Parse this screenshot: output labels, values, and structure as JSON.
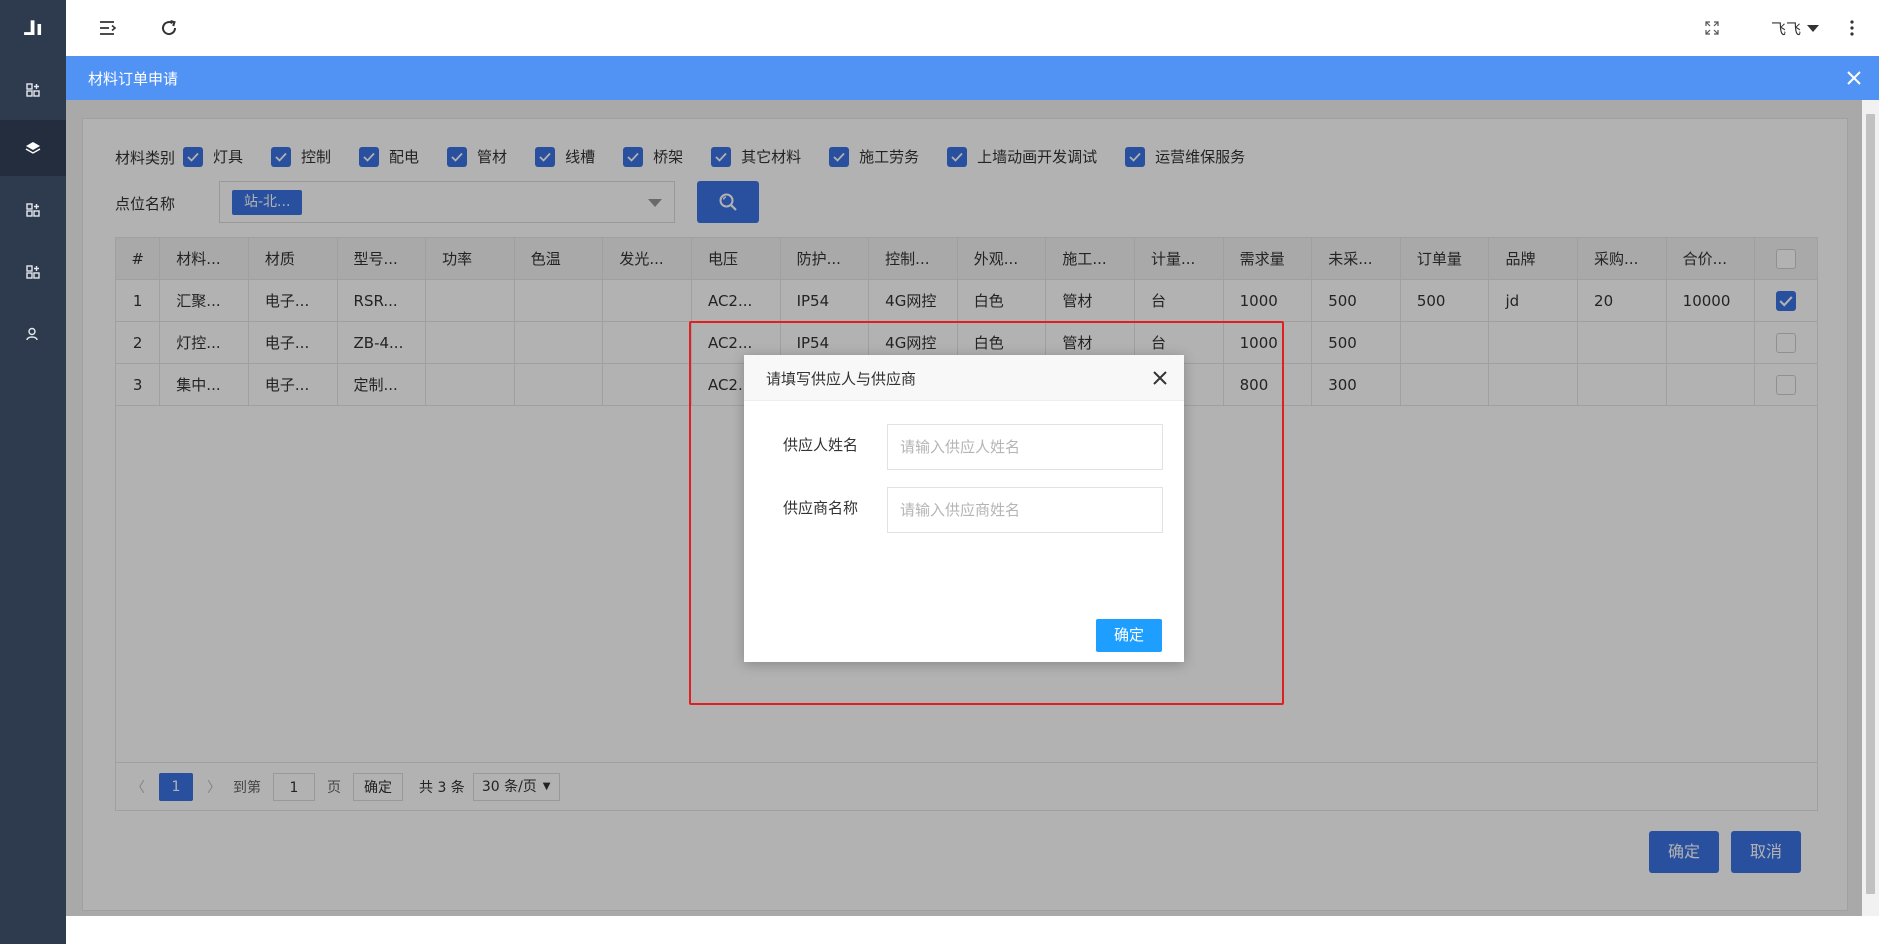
{
  "app": {
    "logo_text": "⅃ı",
    "user_name": "飞飞"
  },
  "panel": {
    "title": "材料订单申请"
  },
  "filters": {
    "category_label": "材料类别",
    "categories": [
      {
        "label": "灯具",
        "checked": true
      },
      {
        "label": "控制",
        "checked": true
      },
      {
        "label": "配电",
        "checked": true
      },
      {
        "label": "管材",
        "checked": true
      },
      {
        "label": "线槽",
        "checked": true
      },
      {
        "label": "桥架",
        "checked": true
      },
      {
        "label": "其它材料",
        "checked": true
      },
      {
        "label": "施工劳务",
        "checked": true
      },
      {
        "label": "上墙动画开发调试",
        "checked": true
      },
      {
        "label": "运营维保服务",
        "checked": true
      }
    ],
    "point_label": "点位名称",
    "point_tag": "站-北..."
  },
  "table": {
    "headers": [
      "#",
      "材料...",
      "材质",
      "型号...",
      "功率",
      "色温",
      "发光...",
      "电压",
      "防护...",
      "控制...",
      "外观...",
      "施工...",
      "计量...",
      "需求量",
      "未采...",
      "订单量",
      "品牌",
      "采购...",
      "合价..."
    ],
    "rows": [
      {
        "cells": [
          "1",
          "汇聚...",
          "电子...",
          "RSR...",
          "",
          "",
          "",
          "AC2...",
          "IP54",
          "4G网控",
          "白色",
          "管材",
          "台",
          "1000",
          "500",
          "500",
          "jd",
          "20",
          "10000"
        ],
        "checked": true
      },
      {
        "cells": [
          "2",
          "灯控...",
          "电子...",
          "ZB-4...",
          "",
          "",
          "",
          "AC2...",
          "IP54",
          "4G网控",
          "白色",
          "管材",
          "台",
          "1000",
          "500",
          "",
          "",
          "",
          ""
        ],
        "checked": false
      },
      {
        "cells": [
          "3",
          "集中...",
          "电子...",
          "定制...",
          "",
          "",
          "",
          "AC2...",
          "",
          "",
          "",
          "",
          "",
          "800",
          "300",
          "",
          "",
          "",
          ""
        ],
        "checked": false
      }
    ]
  },
  "pager": {
    "prev": "〈",
    "page": "1",
    "next": "〉",
    "goto_label": "到第",
    "goto_value": "1",
    "page_unit": "页",
    "confirm": "确定",
    "total": "共 3 条",
    "page_size": "30 条/页"
  },
  "footer": {
    "confirm": "确定",
    "cancel": "取消"
  },
  "dialog": {
    "title": "请填写供应人与供应商",
    "supplier_person_label": "供应人姓名",
    "supplier_person_placeholder": "请输入供应人姓名",
    "supplier_company_label": "供应商名称",
    "supplier_company_placeholder": "请输入供应商姓名",
    "ok": "确定"
  }
}
